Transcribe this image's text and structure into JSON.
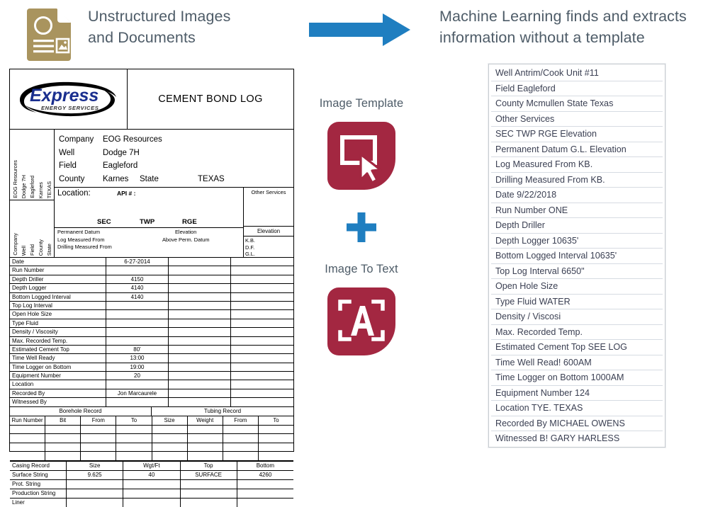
{
  "headers": {
    "left": "Unstructured Images and Documents",
    "left_line1": "Unstructured Images",
    "left_line2": "and Documents",
    "right_line1": "Machine Learning finds and extracts",
    "right_line2": "information without a template"
  },
  "colors": {
    "doc_icon": "#a9945e",
    "arrow_blue": "#1f7ec0",
    "plus_blue": "#1f7ec0",
    "badge_red": "#a32741",
    "header_text": "#4e5c68",
    "list_border": "#d6dbe2",
    "list_text": "#3a3f52"
  },
  "middle": {
    "image_template_label": "Image Template",
    "image_to_text_label": "Image To Text",
    "template_icon": "selection-cursor-icon",
    "plus_icon": "plus-icon",
    "ocr_icon": "text-scan-a-icon",
    "arrow_icon": "right-arrow-icon"
  },
  "extracted": {
    "rows": [
      "Well Antrim/Cook Unit #11",
      "Field Eagleford",
      "County Mcmullen State Texas",
      "Other Services",
      "SEC TWP RGE Elevation",
      "Permanent Datum G.L. Elevation",
      "Log Measured From KB.",
      "Drilling Measured From KB.",
      "Date 9/22/2018",
      "Run Number ONE",
      "Depth Driller",
      "Depth Logger 10635'",
      "Bottom Logged Interval 10635'",
      "Top Log Interval 6650\"",
      "Open Hole Size",
      "Type Fluid WATER",
      "Density / Viscosi",
      "Max. Recorded Temp.",
      "Estimated Cement Top SEE LOG",
      "Time Well Read! 600AM",
      "Time Logger on Bottom 1000AM",
      "Equipment Number 124",
      "Location TYE. TEXAS",
      "Recorded By MICHAEL OWENS",
      "Witnessed B! GARY HARLESS"
    ]
  },
  "form": {
    "logo_main": "Express",
    "logo_sub": "ENERGY SERVICES",
    "title": "CEMENT BOND LOG",
    "company_rows": [
      {
        "key": "Company",
        "value": "EOG Resources",
        "key2": "",
        "value2": ""
      },
      {
        "key": "Well",
        "value": "Dodge 7H",
        "key2": "",
        "value2": ""
      },
      {
        "key": "Field",
        "value": "Eagleford",
        "key2": "",
        "value2": ""
      },
      {
        "key": "County",
        "value": "Karnes",
        "key2": "State",
        "value2": "TEXAS"
      }
    ],
    "vertical_top": [
      "EOG Resources",
      "Dodge 7H",
      "Eagleford",
      "Karnes",
      "TEXAS"
    ],
    "vertical_bottom": [
      "Company",
      "Well",
      "Field",
      "County",
      "State"
    ],
    "location_label": "Location:",
    "api_label": "API # :",
    "sec": "SEC",
    "twp": "TWP",
    "rge": "RGE",
    "permanent_datum": "Permanent Datum",
    "log_measured_from": "Log Measured From",
    "drilling_measured_from": "Drilling Measured From",
    "elevation_word": "Elevation",
    "above_perm_datum": "Above Perm. Datum",
    "other_services": "Other Services",
    "elevation_title": "Elevation",
    "elevation_items": [
      "K.B.",
      "D.F.",
      "G.L."
    ],
    "data_rows": [
      {
        "label": "Date",
        "value": "6-27-2014"
      },
      {
        "label": "Run Number",
        "value": ""
      },
      {
        "label": "Depth Driller",
        "value": "4150"
      },
      {
        "label": "Depth Logger",
        "value": "4140"
      },
      {
        "label": "Bottom Logged Interval",
        "value": "4140"
      },
      {
        "label": "Top Log Interval",
        "value": ""
      },
      {
        "label": "Open Hole Size",
        "value": ""
      },
      {
        "label": "Type Fluid",
        "value": ""
      },
      {
        "label": "Density / Viscosity",
        "value": ""
      },
      {
        "label": "Max. Recorded Temp.",
        "value": ""
      },
      {
        "label": "Estimated Cement Top",
        "value": "80'"
      },
      {
        "label": "Time Well Ready",
        "value": "13:00"
      },
      {
        "label": "Time Logger on Bottom",
        "value": "19:00"
      },
      {
        "label": "Equipment Number",
        "value": "20"
      },
      {
        "label": "Location",
        "value": ""
      },
      {
        "label": "Recorded By",
        "value": "Jon Marcaurele"
      },
      {
        "label": "Witnessed By",
        "value": ""
      }
    ],
    "borehole_title": "Borehole Record",
    "tubing_title": "Tubing Record",
    "bt_columns": [
      "Run Number",
      "Bit",
      "From",
      "To",
      "Size",
      "Weight",
      "From",
      "To"
    ],
    "bt_empty_rows": 4,
    "casing_header": {
      "label": "Casing Record",
      "size": "Size",
      "wgt": "Wgt/Ft",
      "top": "Top",
      "bottom": "Bottom"
    },
    "casing_rows": [
      {
        "label": "Surface String",
        "size": "9.625",
        "wgt": "40",
        "top": "SURFACE",
        "bottom": "4260"
      },
      {
        "label": "Prot. String",
        "size": "",
        "wgt": "",
        "top": "",
        "bottom": ""
      },
      {
        "label": "Production String",
        "size": "",
        "wgt": "",
        "top": "",
        "bottom": ""
      },
      {
        "label": "Liner",
        "size": "",
        "wgt": "",
        "top": "",
        "bottom": ""
      }
    ]
  }
}
